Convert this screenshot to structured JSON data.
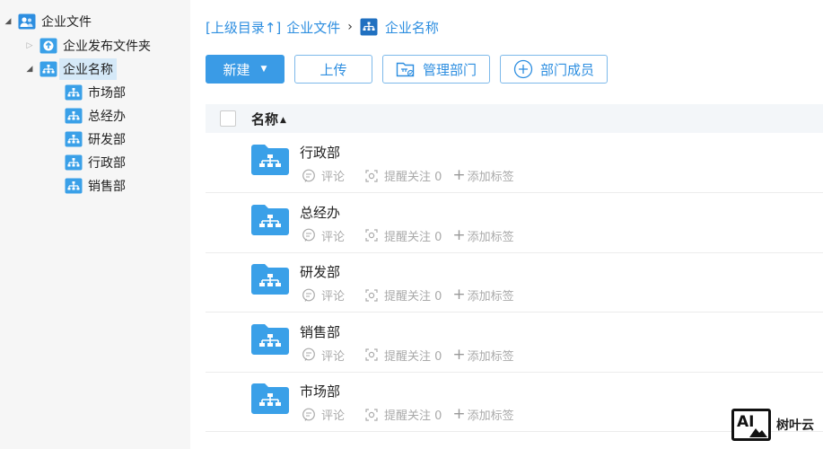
{
  "tree": {
    "root": {
      "label": "企业文件",
      "expanded": true
    },
    "items": [
      {
        "label": "企业发布文件夹",
        "expanded": false
      },
      {
        "label": "企业名称",
        "expanded": true,
        "selected": true,
        "children": [
          {
            "label": "市场部"
          },
          {
            "label": "总经办"
          },
          {
            "label": "研发部"
          },
          {
            "label": "行政部"
          },
          {
            "label": "销售部"
          }
        ]
      }
    ]
  },
  "breadcrumb": {
    "up_label": "[上级目录↑]",
    "parent": "企业文件",
    "separator": "›",
    "current": "企业名称"
  },
  "toolbar": {
    "new_label": "新建",
    "upload_label": "上传",
    "manage_dept_label": "管理部门",
    "members_label": "部门成员"
  },
  "list": {
    "header_name": "名称",
    "rows": [
      {
        "name": "行政部",
        "comment": "评论",
        "remind": "提醒关注 0",
        "tag": "添加标签"
      },
      {
        "name": "总经办",
        "comment": "评论",
        "remind": "提醒关注 0",
        "tag": "添加标签"
      },
      {
        "name": "研发部",
        "comment": "评论",
        "remind": "提醒关注 0",
        "tag": "添加标签"
      },
      {
        "name": "销售部",
        "comment": "评论",
        "remind": "提醒关注 0",
        "tag": "添加标签"
      },
      {
        "name": "市场部",
        "comment": "评论",
        "remind": "提醒关注 0",
        "tag": "添加标签"
      }
    ]
  },
  "watermark": {
    "logo_text": "AI",
    "name": "树叶云"
  },
  "colors": {
    "accent": "#2d8ee0",
    "primary_button": "#3a9be6",
    "folder": "#3aa0e8",
    "sidebar_bg": "#f6f6f6"
  }
}
